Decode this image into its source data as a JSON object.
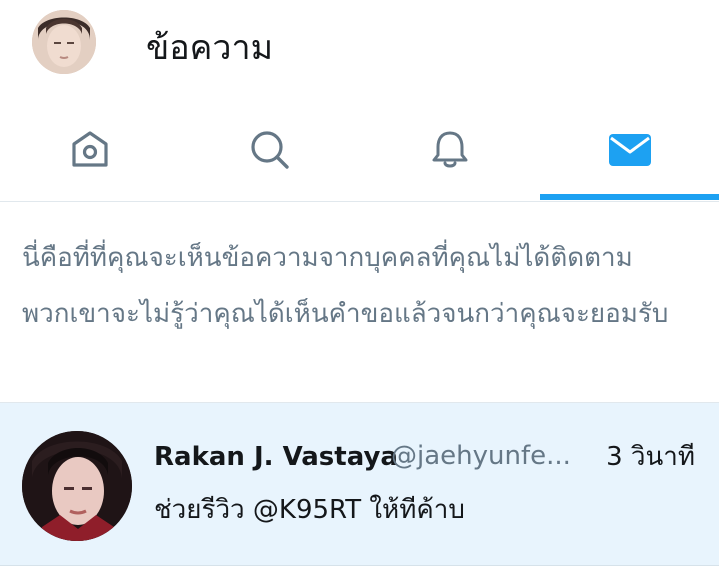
{
  "header": {
    "title": "ข้อความ",
    "avatar_icon": "user-avatar-icon"
  },
  "tabs": [
    {
      "name": "home",
      "icon": "home-icon",
      "active": false
    },
    {
      "name": "search",
      "icon": "search-icon",
      "active": false
    },
    {
      "name": "notifications",
      "icon": "bell-icon",
      "active": false
    },
    {
      "name": "messages",
      "icon": "envelope-icon",
      "active": true
    }
  ],
  "notice": {
    "text": "นี่คือที่ที่คุณจะเห็นข้อความจากบุคคลที่คุณไม่ได้ติดตาม พวกเขาจะไม่รู้ว่าคุณได้เห็นคำขอแล้วจนกว่าคุณจะยอมรับ"
  },
  "conversations": [
    {
      "name": "Rakan J. Vastaya",
      "handle": "@jaehyunfe...",
      "time": "3 วินาที",
      "message": "ช่วยรีวิว @K95RT ให้ทีค้าบ"
    }
  ],
  "colors": {
    "accent": "#1da1f2",
    "icon_inactive": "#657786",
    "row_highlight": "#e8f4fd",
    "text_primary": "#14171a",
    "text_secondary": "#657786"
  }
}
